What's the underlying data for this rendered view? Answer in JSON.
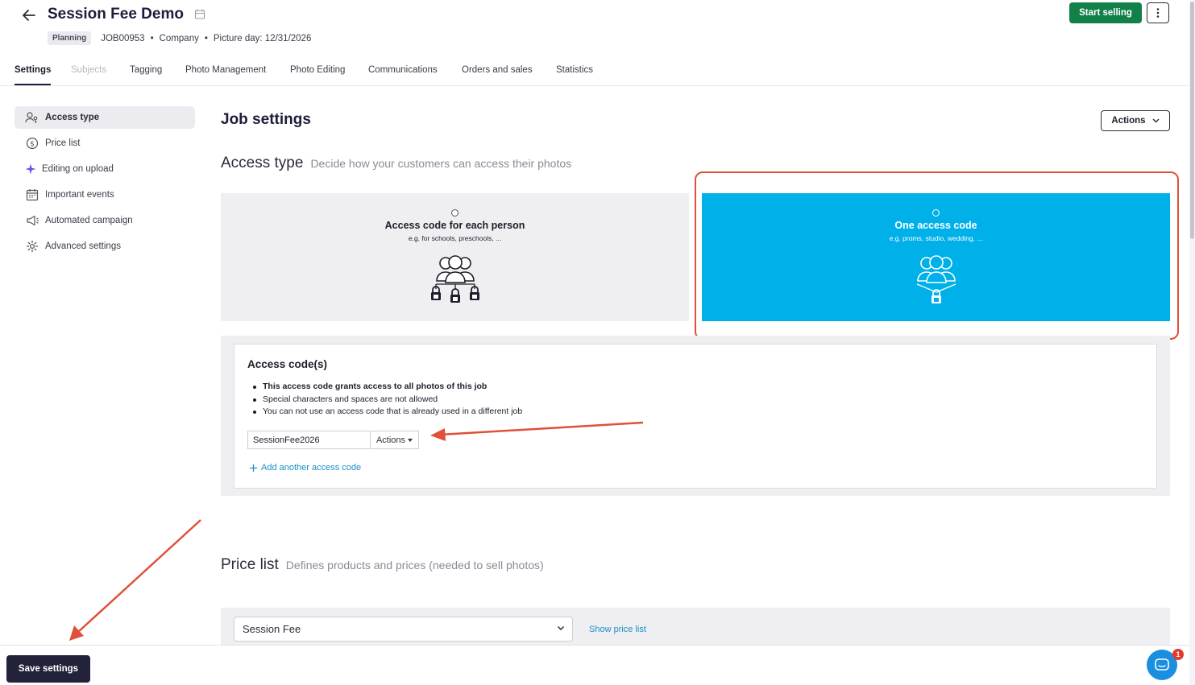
{
  "header": {
    "title": "Session Fee Demo",
    "status_badge": "Planning",
    "job_id": "JOB00953",
    "type": "Company",
    "picture_day": "Picture day: 12/31/2026",
    "start_selling_label": "Start selling"
  },
  "tabs": [
    {
      "label": "Settings",
      "state": "active"
    },
    {
      "label": "Subjects",
      "state": "disabled"
    },
    {
      "label": "Tagging",
      "state": "normal"
    },
    {
      "label": "Photo Management",
      "state": "normal"
    },
    {
      "label": "Photo Editing",
      "state": "normal"
    },
    {
      "label": "Communications",
      "state": "normal"
    },
    {
      "label": "Orders and sales",
      "state": "normal"
    },
    {
      "label": "Statistics",
      "state": "normal"
    }
  ],
  "sidebar": {
    "items": [
      {
        "label": "Access type",
        "icon": "users-key-icon",
        "active": true
      },
      {
        "label": "Price list",
        "icon": "dollar-circle-icon",
        "active": false
      },
      {
        "label": "Editing on upload",
        "icon": "sparkle-icon",
        "active": false
      },
      {
        "label": "Important events",
        "icon": "calendar-icon",
        "active": false
      },
      {
        "label": "Automated campaign",
        "icon": "megaphone-icon",
        "active": false
      },
      {
        "label": "Advanced settings",
        "icon": "gear-icon",
        "active": false
      }
    ]
  },
  "main": {
    "title": "Job settings",
    "actions_label": "Actions",
    "access_type": {
      "heading": "Access type",
      "subheading": "Decide how your customers can access their photos",
      "options": [
        {
          "title": "Access code for each person",
          "subtitle": "e.g. for schools, preschools, ...",
          "selected": false
        },
        {
          "title": "One access code",
          "subtitle": "e.g. proms, studio, wedding, ...",
          "selected": true
        }
      ]
    },
    "access_codes": {
      "title": "Access code(s)",
      "rules": [
        "This access code grants access to all photos of this job",
        "Special characters and spaces are not allowed",
        "You can not use an access code that is already used in a different job"
      ],
      "code_value": "SessionFee2026",
      "actions_label": "Actions",
      "add_label": "Add another access code"
    },
    "price_list": {
      "heading": "Price list",
      "subheading": "Defines products and prices (needed to sell photos)",
      "selected": "Session Fee",
      "show_link": "Show price list"
    }
  },
  "footer": {
    "save_label": "Save settings"
  },
  "chat": {
    "badge_count": "1"
  },
  "colors": {
    "accent_selected": "#00b0e8",
    "start_selling": "#128049",
    "save_button": "#22223b",
    "annotation": "#e0503a",
    "link": "#1a8fc6"
  }
}
